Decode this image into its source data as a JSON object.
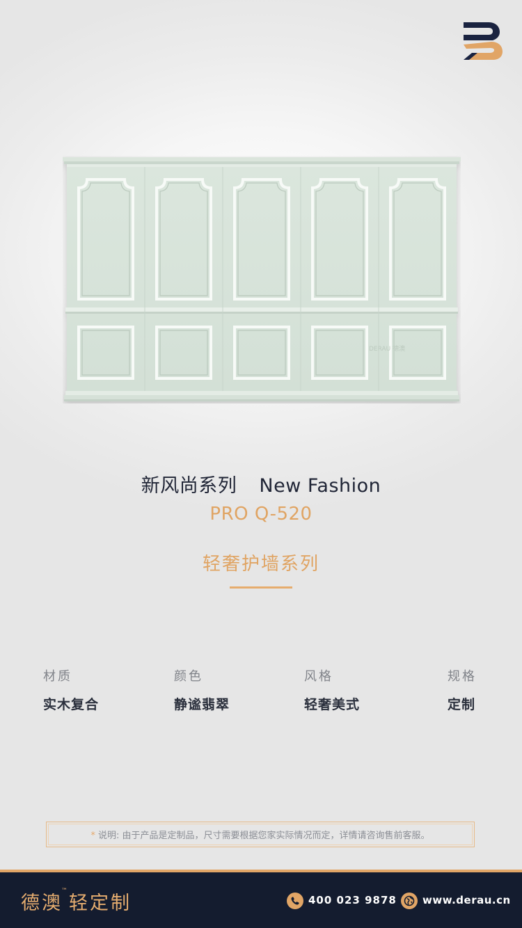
{
  "logo": {
    "icon": "derau-logo-icon",
    "colors": {
      "dark": "#1a2340",
      "accent": "#e1a566"
    }
  },
  "product_image": {
    "icon": "wall-panel-illustration",
    "watermark": "DERAU 德澳",
    "panel_color": "#d6e3d9",
    "upper_panel_count": 5,
    "lower_panel_count": 5
  },
  "product": {
    "series_cn": "新风尚系列",
    "series_en": "New Fashion",
    "model": "PRO Q-520",
    "category": "轻奢护墙系列"
  },
  "specs": [
    {
      "label": "材质",
      "value": "实木复合"
    },
    {
      "label": "颜色",
      "value": "静谧翡翠"
    },
    {
      "label": "风格",
      "value": "轻奢美式"
    },
    {
      "label": "规格",
      "value": "定制"
    }
  ],
  "note": {
    "marker": "*",
    "text": "说明: 由于产品是定制品，尺寸需要根据您家实际情况而定，详情请咨询售前客服。"
  },
  "footer": {
    "brand": "德澳",
    "brand_tm": "™",
    "brand_suffix": "轻定制",
    "phone": "400 023 9878",
    "website": "www.derau.cn"
  },
  "colors": {
    "accent": "#e1a566",
    "footer_bg": "#141c2f",
    "title": "#1f2435"
  }
}
